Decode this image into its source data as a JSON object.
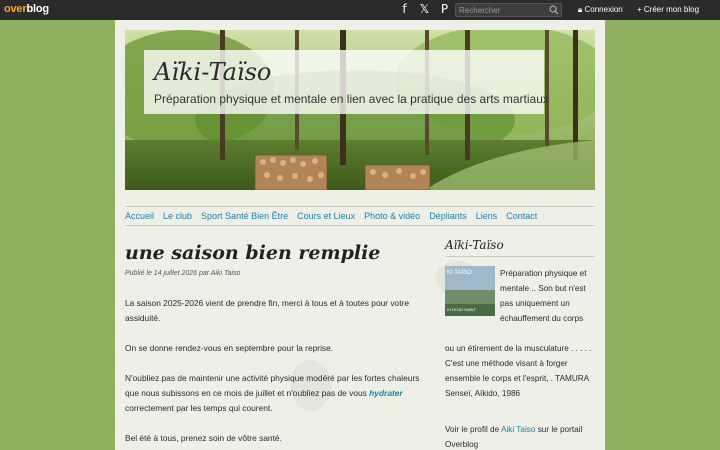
{
  "topbar": {
    "logo_over": "over",
    "logo_blog": "blog",
    "search_placeholder": "Rechercher",
    "login_label": "Connexion",
    "create_label": "Créer mon blog",
    "social": [
      {
        "name": "facebook-icon",
        "glyph": "f"
      },
      {
        "name": "x-icon",
        "glyph": "𝕏"
      },
      {
        "name": "pinterest-icon",
        "glyph": "P"
      }
    ]
  },
  "header": {
    "title": "Aïki-Taïso",
    "subtitle": "Préparation physique et mentale en lien avec la pratique des arts martiaux"
  },
  "nav": {
    "items": [
      "Accueil",
      "Le club",
      "Sport Santé Bien Être",
      "Cours et Lieux",
      "Photo & vidéo",
      "Dépliants",
      "Liens",
      "Contact"
    ]
  },
  "post": {
    "title": "une saison bien remplie",
    "meta": "Publié le 14 juillet 2026 par Aiki Taiso",
    "p1": "La saison 2025-2026 vient de prendre fin, merci à tous et à toutes pour votre assiduité.",
    "p2": "On se donne rendez-vous en septembre pour la reprise.",
    "p3_a": "N'oubliez pas de maintenir une activité physique modéré par les fortes chaleurs que nous subissons en ce mois de juillet et n'oubliez pas de vous ",
    "p3_link": "hydrater",
    "p3_b": " correc­tement par les temps qui courent.",
    "p4": "Bel été à tous, prenez soin de vôtre santé."
  },
  "sidebar": {
    "title": "Aïki-Taïso",
    "thumb_caption": "KI TAÏSO",
    "thumb_caption2": "KI DOJO SAINT",
    "text_top": "Préparation physique et mentale .. Son but n'est pas uniquement un échauffement du corps",
    "text_bottom": "ou un étirement de la musculature . . . . . C'est une méthode visant à forger ensemble le corps et l'esprit, . TAMURA Senseï, Aïkido, 1986",
    "profile_a": "Voir le profil de ",
    "profile_link": "Aiki Taiso",
    "profile_b": " sur le portail Overblog"
  },
  "colors": {
    "background": "#8fb060",
    "link": "#1f7fa6",
    "topbar": "#2b2b2b"
  }
}
